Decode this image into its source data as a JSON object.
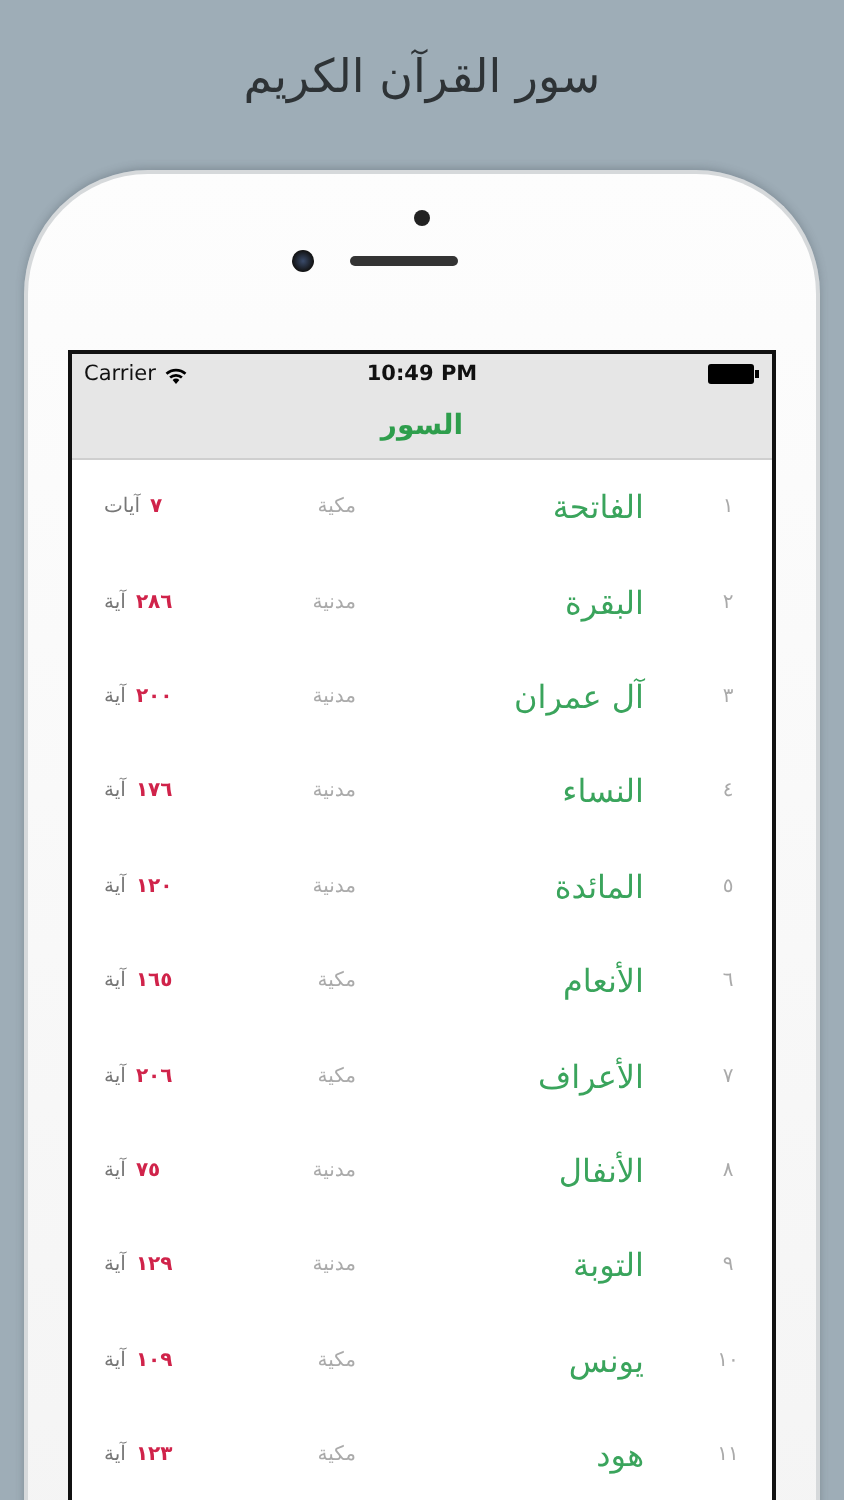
{
  "headline": "سور القرآن الكريم",
  "status_bar": {
    "carrier": "Carrier",
    "time": "10:49 PM"
  },
  "nav_bar": {
    "title": "السور"
  },
  "surahs": [
    {
      "number": "١",
      "name": "الفاتحة",
      "type": "مكية",
      "count": "٧",
      "unit": "آيات"
    },
    {
      "number": "٢",
      "name": "البقرة",
      "type": "مدنية",
      "count": "٢٨٦",
      "unit": "آية"
    },
    {
      "number": "٣",
      "name": "آل عمران",
      "type": "مدنية",
      "count": "٢٠٠",
      "unit": "آية"
    },
    {
      "number": "٤",
      "name": "النساء",
      "type": "مدنية",
      "count": "١٧٦",
      "unit": "آية"
    },
    {
      "number": "٥",
      "name": "المائدة",
      "type": "مدنية",
      "count": "١٢٠",
      "unit": "آية"
    },
    {
      "number": "٦",
      "name": "الأنعام",
      "type": "مكية",
      "count": "١٦٥",
      "unit": "آية"
    },
    {
      "number": "٧",
      "name": "الأعراف",
      "type": "مكية",
      "count": "٢٠٦",
      "unit": "آية"
    },
    {
      "number": "٨",
      "name": "الأنفال",
      "type": "مدنية",
      "count": "٧٥",
      "unit": "آية"
    },
    {
      "number": "٩",
      "name": "التوبة",
      "type": "مدنية",
      "count": "١٢٩",
      "unit": "آية"
    },
    {
      "number": "١٠",
      "name": "يونس",
      "type": "مكية",
      "count": "١٠٩",
      "unit": "آية"
    },
    {
      "number": "١١",
      "name": "هود",
      "type": "مكية",
      "count": "١٢٣",
      "unit": "آية"
    }
  ]
}
